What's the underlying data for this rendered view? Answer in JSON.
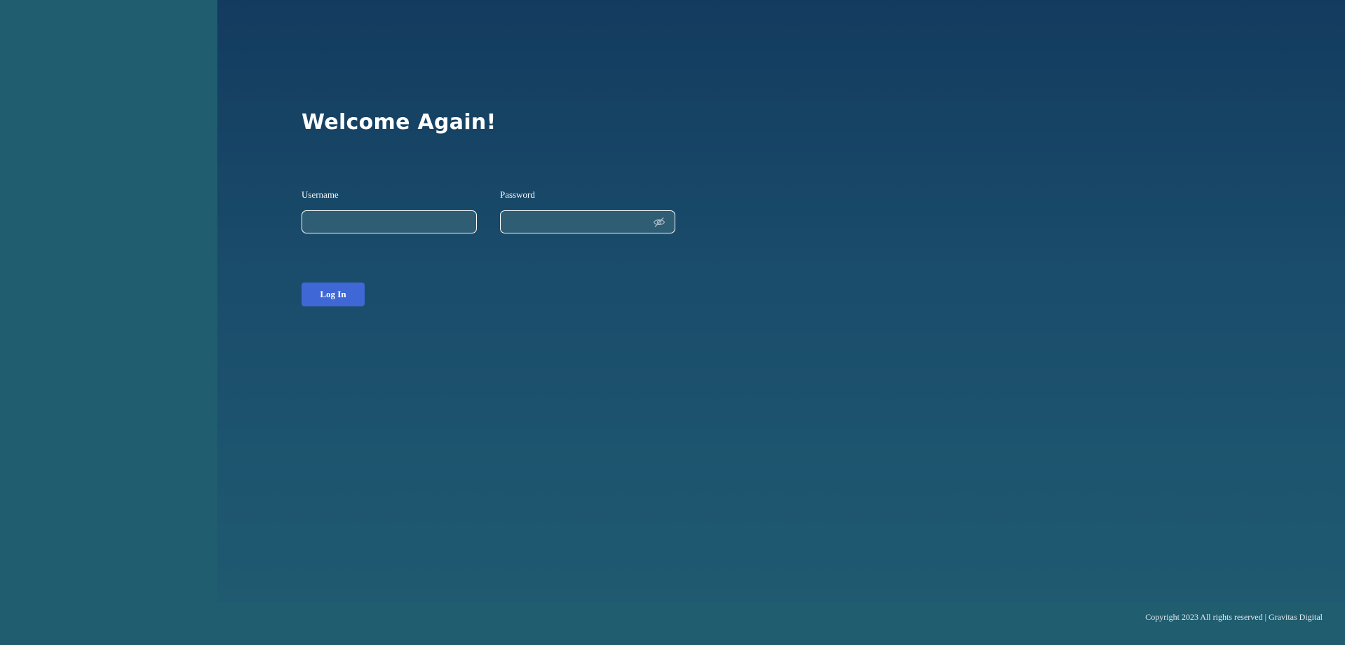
{
  "page": {
    "title": "Welcome Again!"
  },
  "login_form": {
    "username_label": "Username",
    "username_value": "",
    "password_label": "Password",
    "password_value": "",
    "password_toggle_icon": "eye-slash-icon",
    "submit_label": "Log In"
  },
  "footer": {
    "copyright": "Copyright 2023 All rights reserved | Gravitas Digital"
  },
  "colors": {
    "accent": "#3f67d6",
    "background_dark": "#133b5f",
    "background_light": "#1f5d6f"
  }
}
